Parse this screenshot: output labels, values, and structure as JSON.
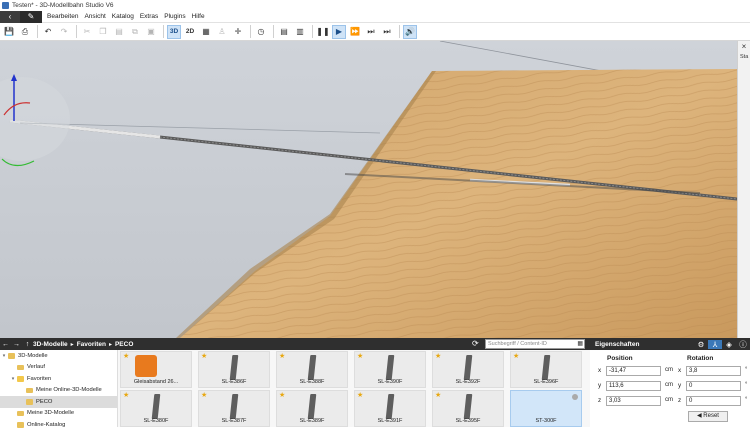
{
  "window": {
    "title": "Testen* - 3D-Modellbahn Studio V6"
  },
  "menu": {
    "items": [
      "Bearbeiten",
      "Ansicht",
      "Katalog",
      "Extras",
      "Plugins",
      "Hilfe"
    ]
  },
  "toolbar": {
    "mode_3d": "3D",
    "mode_2d": "2D"
  },
  "viewport": {
    "side_tab_close": "×",
    "side_tab_label": "Sta"
  },
  "browser": {
    "breadcrumb": [
      "3D-Modelle",
      "Favoriten",
      "PECO"
    ],
    "search_placeholder": "Suchbegriff / Content-ID"
  },
  "tree": {
    "items": [
      {
        "label": "3D-Modelle",
        "level": 0,
        "expander": "▾"
      },
      {
        "label": "Verlauf",
        "level": 1,
        "expander": ""
      },
      {
        "label": "Favoriten",
        "level": 1,
        "expander": "▾"
      },
      {
        "label": "Meine Online-3D-Modelle",
        "level": 2,
        "expander": ""
      },
      {
        "label": "PECO",
        "level": 2,
        "expander": "",
        "selected": true
      },
      {
        "label": "Meine 3D-Modelle",
        "level": 1,
        "expander": ""
      },
      {
        "label": "Online-Katalog",
        "level": 1,
        "expander": ""
      }
    ]
  },
  "thumbnails": [
    {
      "label": "Gleisabstand 26...",
      "kind": "box"
    },
    {
      "label": "SL-E386F",
      "kind": "track"
    },
    {
      "label": "SL-E388F",
      "kind": "track"
    },
    {
      "label": "SL-E390F",
      "kind": "track"
    },
    {
      "label": "SL-E392F",
      "kind": "track"
    },
    {
      "label": "SL-E396F",
      "kind": "track"
    },
    {
      "label": "SL-E380F",
      "kind": "track"
    },
    {
      "label": "SL-E387F",
      "kind": "track"
    },
    {
      "label": "SL-E389F",
      "kind": "track"
    },
    {
      "label": "SL-E391F",
      "kind": "track"
    },
    {
      "label": "SL-E395F",
      "kind": "track"
    },
    {
      "label": "ST-300F",
      "kind": "selected"
    }
  ],
  "properties": {
    "title": "Eigenschaften",
    "position_header": "Position",
    "rotation_header": "Rotation",
    "position": [
      {
        "axis": "x",
        "value": "-31,47",
        "unit": "cm"
      },
      {
        "axis": "y",
        "value": "113,6",
        "unit": "cm"
      },
      {
        "axis": "z",
        "value": "3,03",
        "unit": "cm"
      }
    ],
    "rotation": [
      {
        "axis": "x",
        "value": "3,8",
        "unit": "°"
      },
      {
        "axis": "y",
        "value": "0",
        "unit": "°"
      },
      {
        "axis": "z",
        "value": "0",
        "unit": "°"
      }
    ],
    "reset_label": "Reset"
  },
  "colors": {
    "accent": "#3a78b8",
    "dark_bar": "#2f2f2f",
    "wood": "#d9ad72"
  }
}
